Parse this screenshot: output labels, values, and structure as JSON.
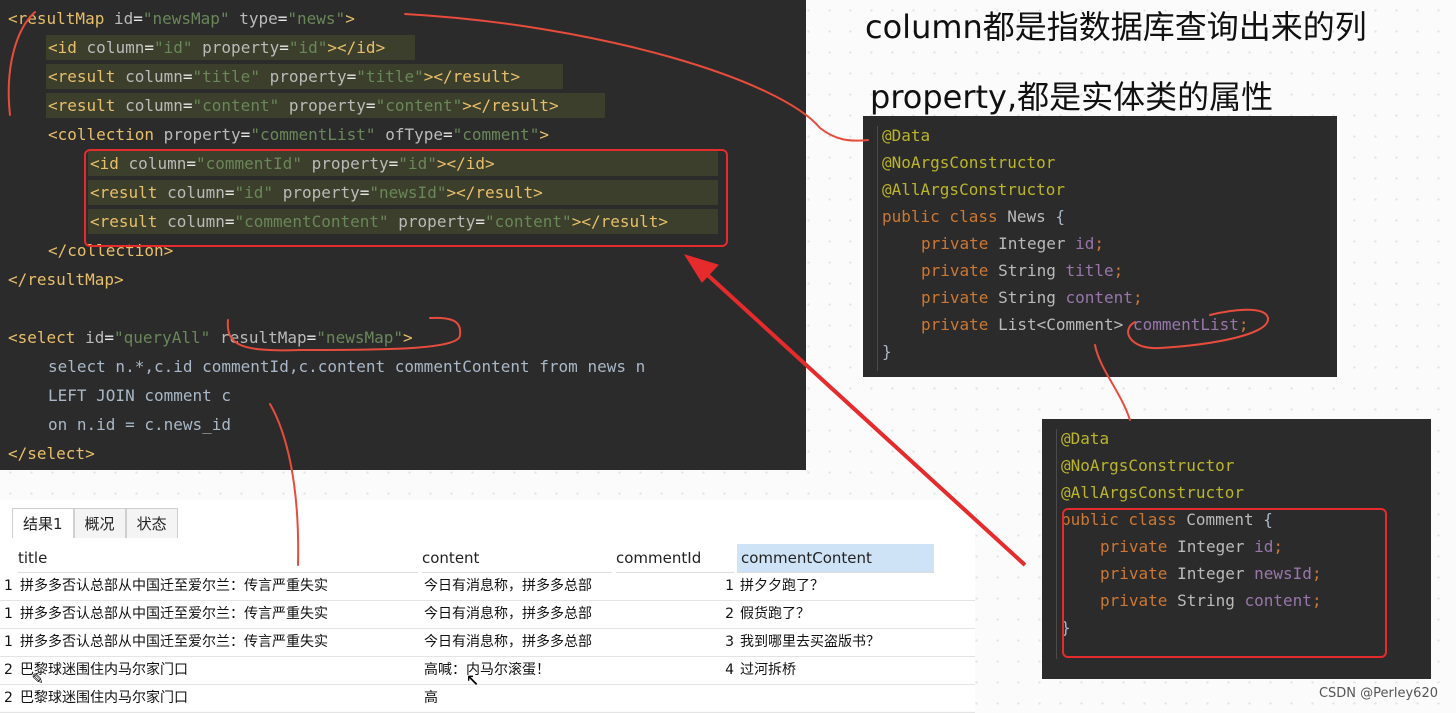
{
  "notes": {
    "line1": "column都是指数据库查询出来的列",
    "line2": "property,都是实体类的属性"
  },
  "xml_editor": {
    "lines": [
      "<resultMap id=\"newsMap\" type=\"news\">",
      "<id column=\"id\" property=\"id\"></id>",
      "<result column=\"title\" property=\"title\"></result>",
      "<result column=\"content\" property=\"content\"></result>",
      "<collection property=\"commentList\" ofType=\"comment\">",
      "<id column=\"commentId\" property=\"id\"></id>",
      "<result column=\"id\" property=\"newsId\"></result>",
      "<result column=\"commentContent\" property=\"content\"></result>",
      "</collection>",
      "</resultMap>",
      "",
      "<select id=\"queryAll\" resultMap=\"newsMap\">",
      "select n.*,c.id commentId,c.content commentContent from news n",
      "LEFT JOIN comment c",
      "on n.id = c.news_id",
      "</select>"
    ]
  },
  "news_class": {
    "lines": [
      "@Data",
      "@NoArgsConstructor",
      "@AllArgsConstructor",
      "public class News {",
      "private Integer id;",
      "private String title;",
      "private String content;",
      "private List<Comment> commentList;",
      "}"
    ]
  },
  "comment_class": {
    "lines": [
      "@Data",
      "@NoArgsConstructor",
      "@AllArgsConstructor",
      "public class Comment {",
      "private Integer id;",
      "private Integer newsId;",
      "private String content;",
      "}"
    ]
  },
  "result_panel": {
    "tabs": [
      "结果1",
      "概况",
      "状态"
    ],
    "columns": [
      "title",
      "content",
      "commentId",
      "commentContent"
    ],
    "rows": [
      {
        "id": "1",
        "title": "拼多多否认总部从中国迁至爱尔兰：传言严重失实",
        "content": "今日有消息称，拼多多总部",
        "commentId": "1",
        "commentContent": "拼夕夕跑了？"
      },
      {
        "id": "1",
        "title": "拼多多否认总部从中国迁至爱尔兰：传言严重失实",
        "content": "今日有消息称，拼多多总部",
        "commentId": "2",
        "commentContent": "假货跑了？"
      },
      {
        "id": "1",
        "title": "拼多多否认总部从中国迁至爱尔兰：传言严重失实",
        "content": "今日有消息称，拼多多总部",
        "commentId": "3",
        "commentContent": "我到哪里去买盗版书？"
      },
      {
        "id": "2",
        "title": "巴黎球迷围住内马尔家门口",
        "content": "高喊：内马尔滚蛋！",
        "commentId": "4",
        "commentContent": "过河拆桥"
      },
      {
        "id": "2",
        "title": "巴黎球迷围住内马尔家门口",
        "content": "高",
        "commentId": "",
        "commentContent": ""
      }
    ]
  },
  "watermark": "CSDN @Perley620",
  "colors": {
    "annotation_red": "#e52b2b",
    "editor_bg": "#2b2b2b"
  }
}
